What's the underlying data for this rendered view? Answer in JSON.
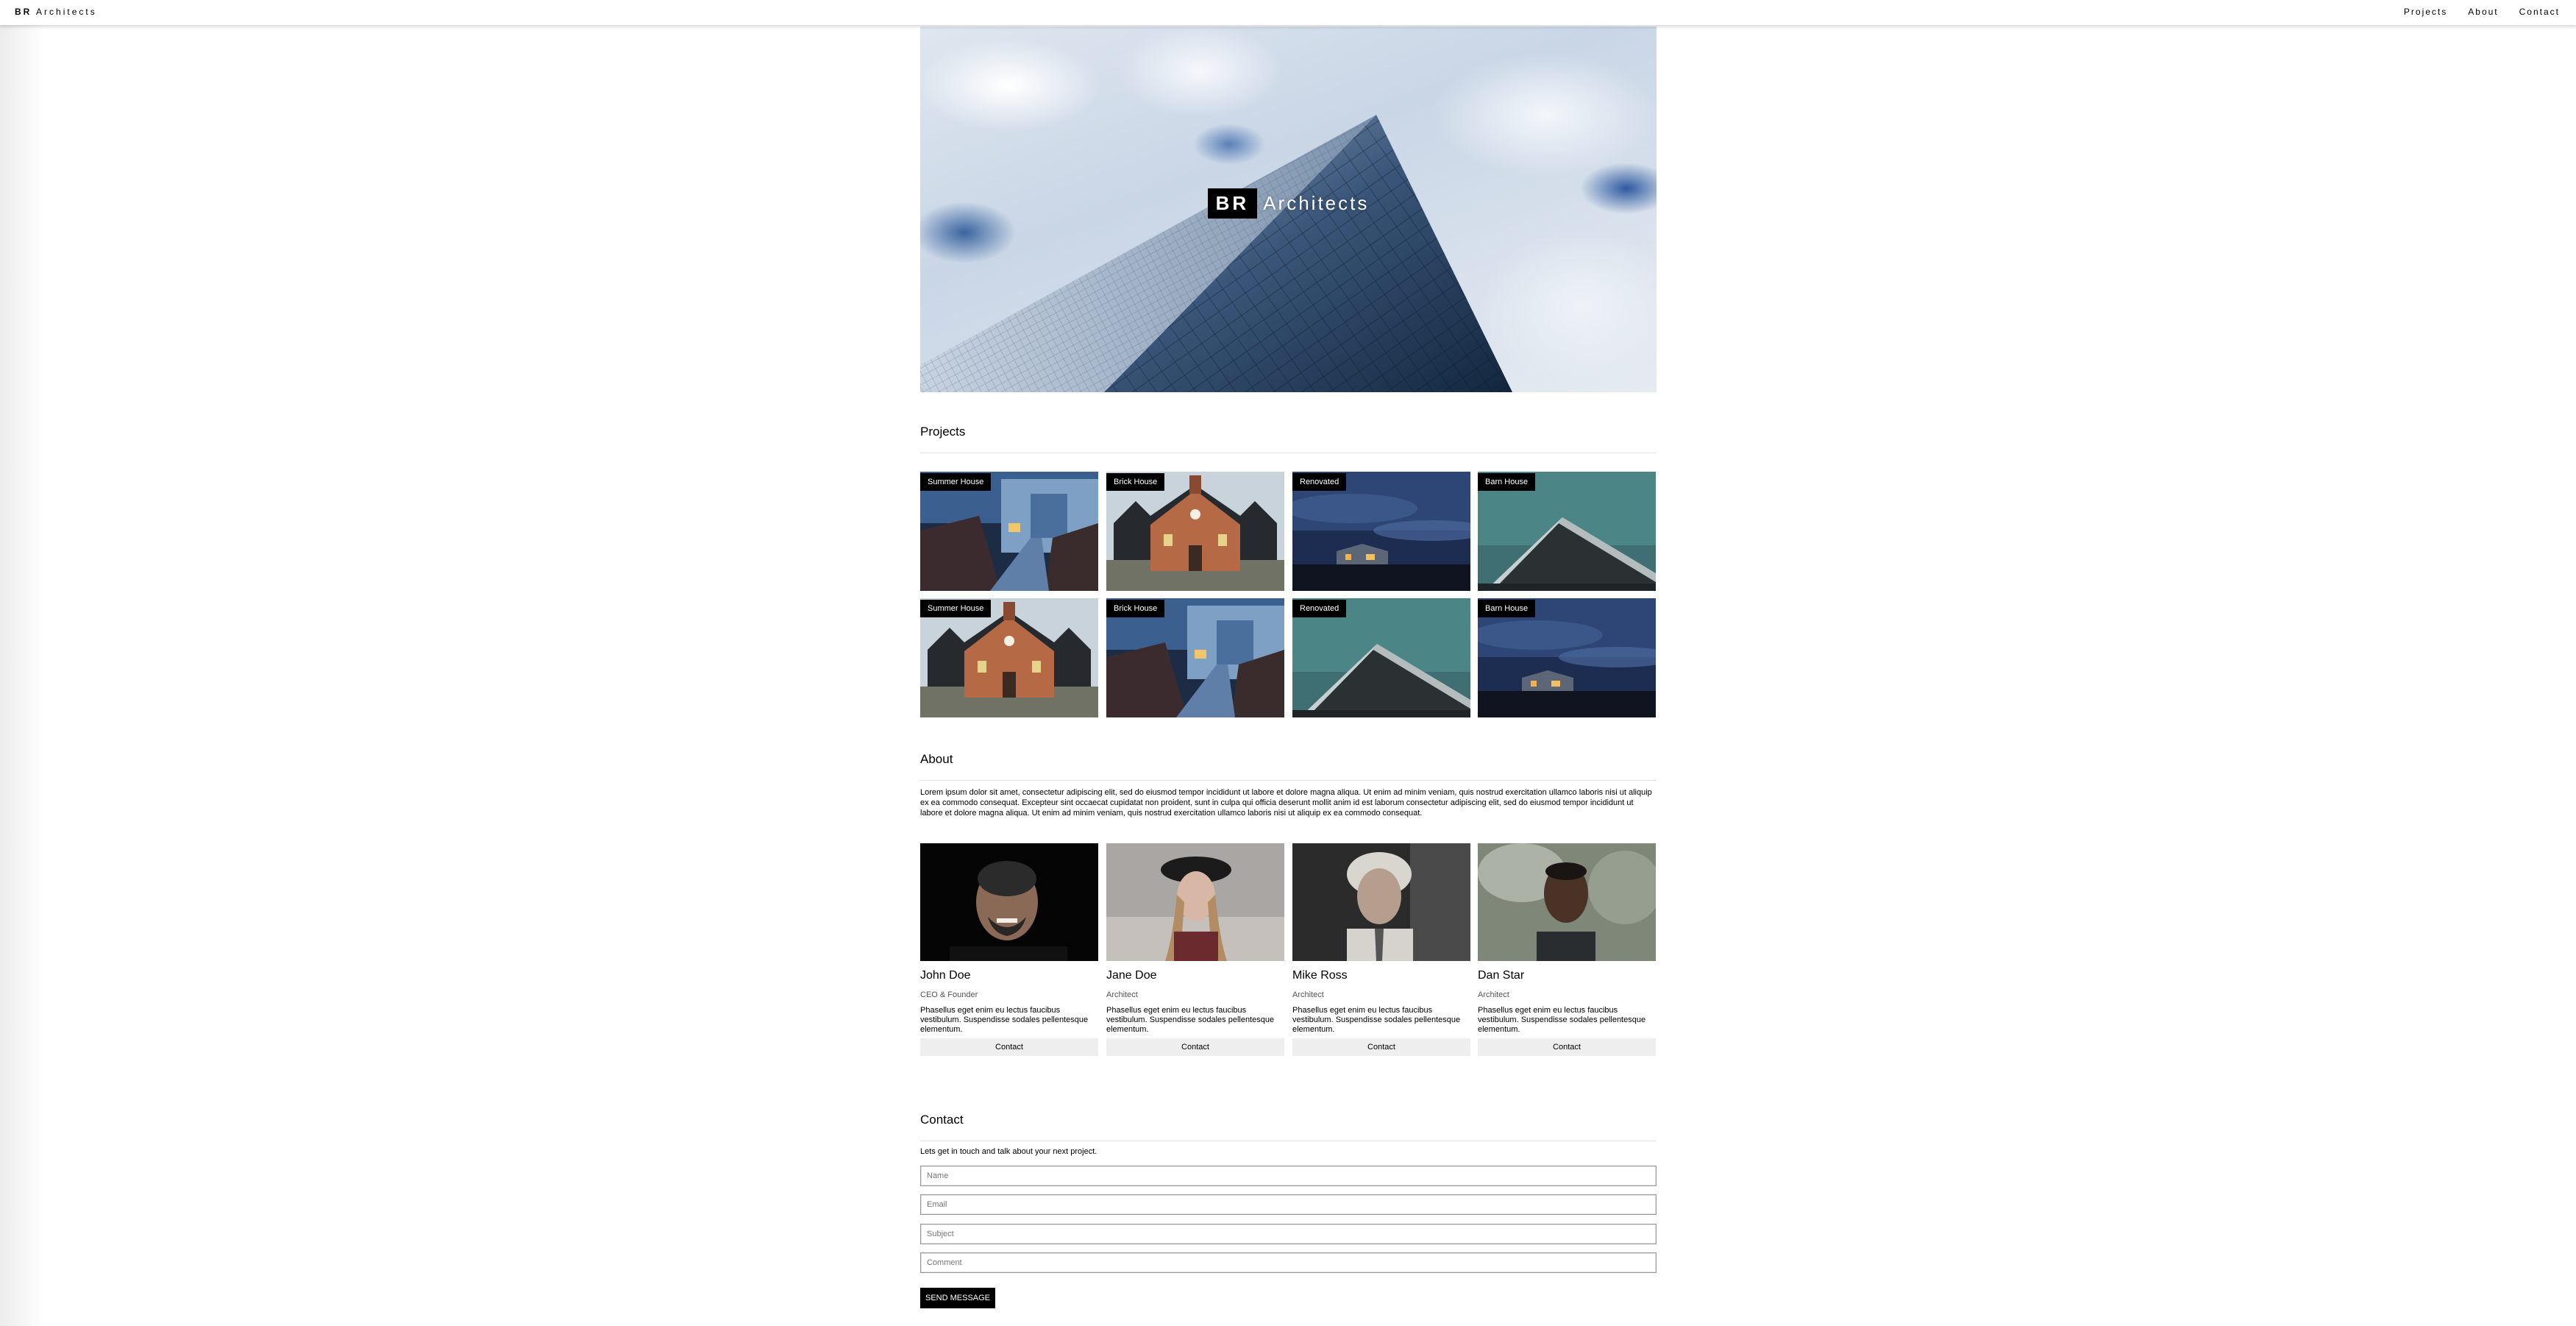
{
  "navbar": {
    "brand_bold": "BR",
    "brand_rest": "Architects",
    "links": [
      "Projects",
      "About",
      "Contact"
    ]
  },
  "hero": {
    "logo_box": "BR",
    "logo_word": "Architects"
  },
  "projects": {
    "title": "Projects",
    "items": [
      {
        "tag": "Summer House",
        "scene": "boardwalk-dusk"
      },
      {
        "tag": "Brick House",
        "scene": "brick-house"
      },
      {
        "tag": "Renovated",
        "scene": "night-cabin"
      },
      {
        "tag": "Barn House",
        "scene": "teal-barn"
      },
      {
        "tag": "Summer House",
        "scene": "brick-house"
      },
      {
        "tag": "Brick House",
        "scene": "boardwalk-dusk"
      },
      {
        "tag": "Renovated",
        "scene": "teal-barn"
      },
      {
        "tag": "Barn House",
        "scene": "night-cabin"
      }
    ]
  },
  "about": {
    "title": "About",
    "text": "Lorem ipsum dolor sit amet, consectetur adipiscing elit, sed do eiusmod tempor incididunt ut labore et dolore magna aliqua. Ut enim ad minim veniam, quis nostrud exercitation ullamco laboris nisi ut aliquip ex ea commodo consequat. Excepteur sint occaecat cupidatat non proident, sunt in culpa qui officia deserunt mollit anim id est laborum consectetur adipiscing elit, sed do eiusmod tempor incididunt ut labore et dolore magna aliqua. Ut enim ad minim veniam, quis nostrud exercitation ullamco laboris nisi ut aliquip ex ea commodo consequat.",
    "team": [
      {
        "name": "John Doe",
        "role": "CEO & Founder",
        "desc": "Phasellus eget enim eu lectus faucibus vestibulum. Suspendisse sodales pellentesque elementum.",
        "button": "Contact"
      },
      {
        "name": "Jane Doe",
        "role": "Architect",
        "desc": "Phasellus eget enim eu lectus faucibus vestibulum. Suspendisse sodales pellentesque elementum.",
        "button": "Contact"
      },
      {
        "name": "Mike Ross",
        "role": "Architect",
        "desc": "Phasellus eget enim eu lectus faucibus vestibulum. Suspendisse sodales pellentesque elementum.",
        "button": "Contact"
      },
      {
        "name": "Dan Star",
        "role": "Architect",
        "desc": "Phasellus eget enim eu lectus faucibus vestibulum. Suspendisse sodales pellentesque elementum.",
        "button": "Contact"
      }
    ]
  },
  "contact": {
    "title": "Contact",
    "lead": "Lets get in touch and talk about your next project.",
    "fields": {
      "name_placeholder": "Name",
      "email_placeholder": "Email",
      "subject_placeholder": "Subject",
      "comment_placeholder": "Comment"
    },
    "send_label": "SEND MESSAGE"
  }
}
